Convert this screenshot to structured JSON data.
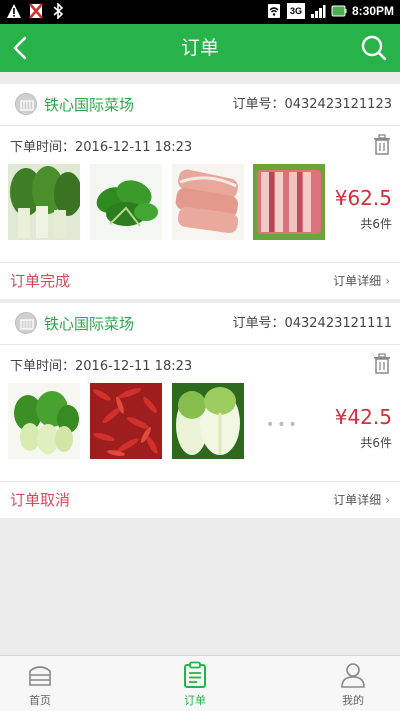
{
  "status_bar": {
    "icons_left": [
      "warning-icon",
      "no-sim-icon",
      "bluetooth-icon"
    ],
    "icons_right": [
      "wifi-icon",
      "3g-signal-icon",
      "signal-bars-icon",
      "battery-icon"
    ],
    "network": "3G",
    "time": "8:30PM"
  },
  "nav": {
    "title": "订单",
    "back_icon": "chevron-left-icon",
    "search_icon": "search-icon",
    "color": "#28b34a"
  },
  "orders": [
    {
      "shop_name": "铁心国际菜场",
      "order_no": "订单号：0432423121123",
      "order_time": "下单时间：2016-12-11   18:23",
      "items": [
        "chinese-cabbage",
        "spinach",
        "pork-loin",
        "pork-ribs"
      ],
      "has_more": false,
      "price": "¥62.5",
      "count": "共6件",
      "status": "订单完成",
      "detail_label": "订单详细"
    },
    {
      "shop_name": "铁心国际菜场",
      "order_no": "订单号：0432423121111",
      "order_time": "下单时间：2016-12-11   18:23",
      "items": [
        "bok-choy",
        "red-chili",
        "napa-cabbage"
      ],
      "has_more": true,
      "more_text": "•••",
      "price": "¥42.5",
      "count": "共6件",
      "status": "订单取消",
      "detail_label": "订单详细"
    }
  ],
  "tabbar": {
    "tabs": [
      {
        "label": "首页",
        "icon": "home-icon",
        "active": false
      },
      {
        "label": "订单",
        "icon": "clipboard-icon",
        "active": true
      },
      {
        "label": "我的",
        "icon": "user-icon",
        "active": false
      }
    ]
  },
  "colors": {
    "accent": "#28b34a",
    "price": "#d32f3b",
    "status": "#d94a57"
  }
}
